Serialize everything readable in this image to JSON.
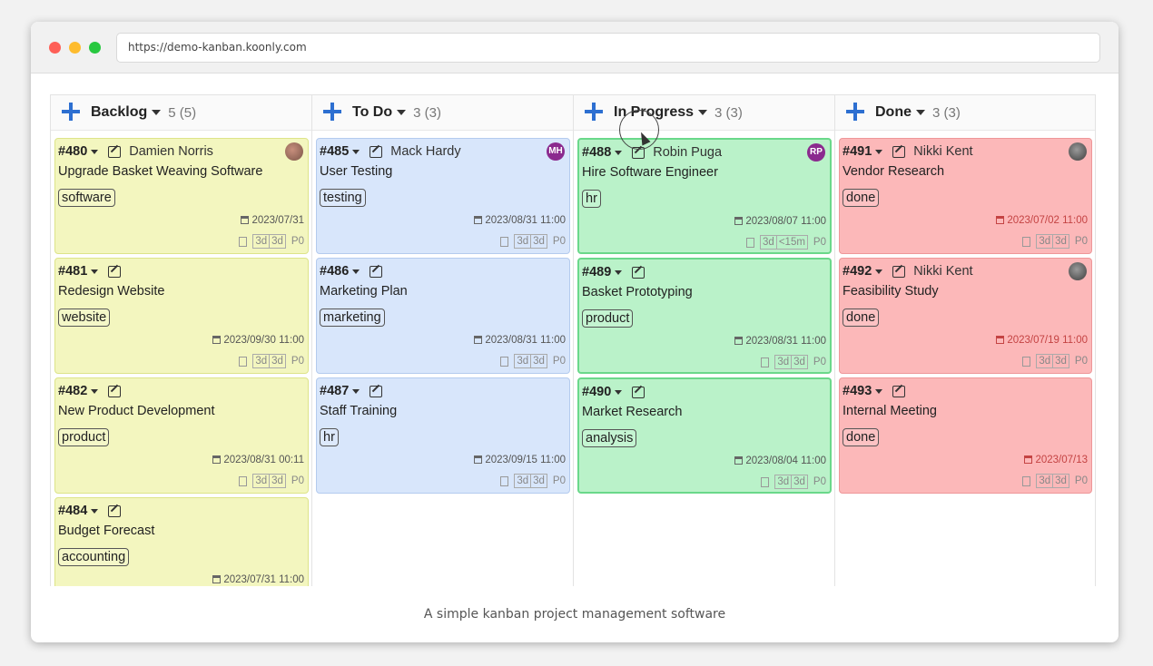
{
  "browser": {
    "url": "https://demo-kanban.koonly.com"
  },
  "columns": [
    {
      "title": "Backlog",
      "count": "5 (5)",
      "variant": "backlog",
      "cards": [
        {
          "id": "#480",
          "assignee": "Damien Norris",
          "avatar": "photo",
          "avatar_text": "",
          "title": "Upgrade Basket Weaving Software",
          "tag": "software",
          "date": "2023/07/31",
          "est1": "3d",
          "est2": "3d",
          "priority": "P0"
        },
        {
          "id": "#481",
          "assignee": "",
          "avatar": "",
          "avatar_text": "",
          "title": "Redesign Website",
          "tag": "website",
          "date": "2023/09/30 11:00",
          "est1": "3d",
          "est2": "3d",
          "priority": "P0"
        },
        {
          "id": "#482",
          "assignee": "",
          "avatar": "",
          "avatar_text": "",
          "title": "New Product Development",
          "tag": "product",
          "date": "2023/08/31 00:11",
          "est1": "3d",
          "est2": "3d",
          "priority": "P0"
        },
        {
          "id": "#484",
          "assignee": "",
          "avatar": "",
          "avatar_text": "",
          "title": "Budget Forecast",
          "tag": "accounting",
          "date": "2023/07/31 11:00",
          "est1": "",
          "est2": "",
          "priority": ""
        }
      ]
    },
    {
      "title": "To Do",
      "count": "3 (3)",
      "variant": "todo",
      "cards": [
        {
          "id": "#485",
          "assignee": "Mack Hardy",
          "avatar": "initials",
          "avatar_text": "MH",
          "title": "User Testing",
          "tag": "testing",
          "date": "2023/08/31 11:00",
          "est1": "3d",
          "est2": "3d",
          "priority": "P0"
        },
        {
          "id": "#486",
          "assignee": "",
          "avatar": "",
          "avatar_text": "",
          "title": "Marketing Plan",
          "tag": "marketing",
          "date": "2023/08/31 11:00",
          "est1": "3d",
          "est2": "3d",
          "priority": "P0"
        },
        {
          "id": "#487",
          "assignee": "",
          "avatar": "",
          "avatar_text": "",
          "title": "Staff Training",
          "tag": "hr",
          "date": "2023/09/15 11:00",
          "est1": "3d",
          "est2": "3d",
          "priority": "P0"
        }
      ]
    },
    {
      "title": "In Progress",
      "count": "3 (3)",
      "variant": "inprog",
      "cards": [
        {
          "id": "#488",
          "assignee": "Robin Puga",
          "avatar": "initials",
          "avatar_text": "RP",
          "title": "Hire Software Engineer",
          "tag": "hr",
          "date": "2023/08/07 11:00",
          "est1": "3d",
          "est2": "<15m",
          "priority": "P0"
        },
        {
          "id": "#489",
          "assignee": "",
          "avatar": "",
          "avatar_text": "",
          "title": "Basket Prototyping",
          "tag": "product",
          "date": "2023/08/31 11:00",
          "est1": "3d",
          "est2": "3d",
          "priority": "P0"
        },
        {
          "id": "#490",
          "assignee": "",
          "avatar": "",
          "avatar_text": "",
          "title": "Market Research",
          "tag": "analysis",
          "date": "2023/08/04 11:00",
          "est1": "3d",
          "est2": "3d",
          "priority": "P0"
        }
      ]
    },
    {
      "title": "Done",
      "count": "3 (3)",
      "variant": "done",
      "cards": [
        {
          "id": "#491",
          "assignee": "Nikki Kent",
          "avatar": "photo2",
          "avatar_text": "",
          "title": "Vendor Research",
          "tag": "done",
          "date": "2023/07/02 11:00",
          "est1": "3d",
          "est2": "3d",
          "priority": "P0"
        },
        {
          "id": "#492",
          "assignee": "Nikki Kent",
          "avatar": "photo2",
          "avatar_text": "",
          "title": "Feasibility Study",
          "tag": "done",
          "date": "2023/07/19 11:00",
          "est1": "3d",
          "est2": "3d",
          "priority": "P0"
        },
        {
          "id": "#493",
          "assignee": "",
          "avatar": "",
          "avatar_text": "",
          "title": "Internal Meeting",
          "tag": "done",
          "date": "2023/07/13",
          "est1": "3d",
          "est2": "3d",
          "priority": "P0"
        }
      ]
    }
  ],
  "caption": "A simple kanban project management software"
}
